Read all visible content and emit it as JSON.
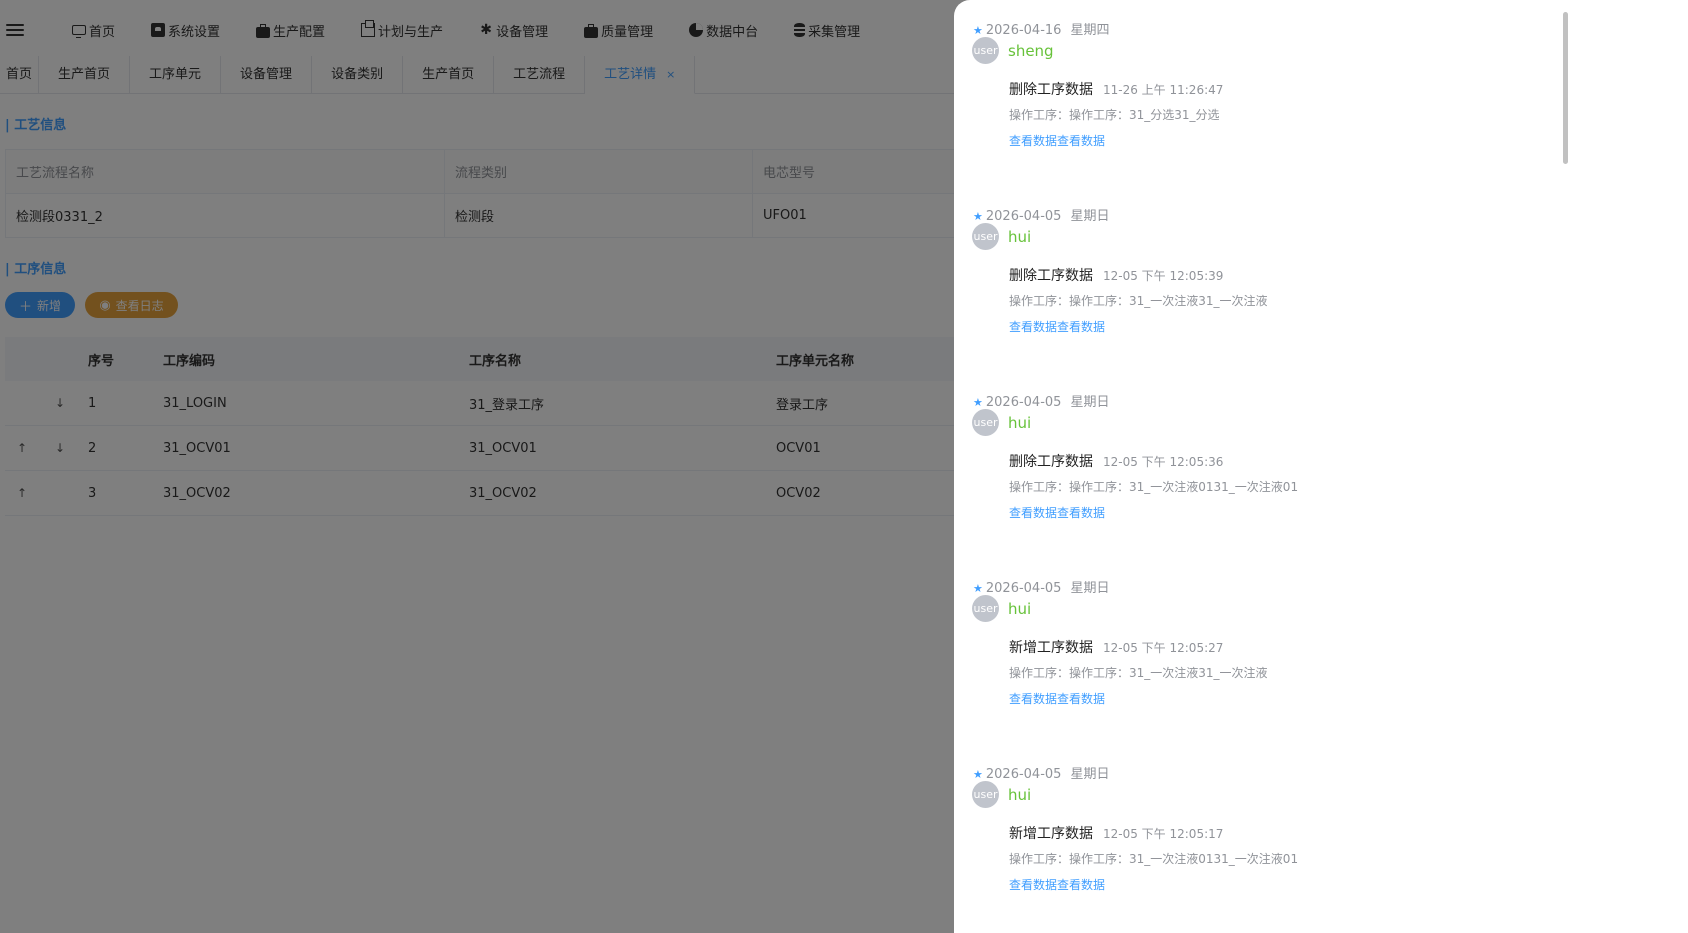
{
  "nav": {
    "items": [
      {
        "label": "首页",
        "icon": "monitor-icon"
      },
      {
        "label": "系统设置",
        "icon": "settings-box-icon"
      },
      {
        "label": "生产配置",
        "icon": "briefcase-icon"
      },
      {
        "label": "计划与生产",
        "icon": "windows-icon"
      },
      {
        "label": "设备管理",
        "icon": "gear-icon"
      },
      {
        "label": "质量管理",
        "icon": "briefcase-icon"
      },
      {
        "label": "数据中台",
        "icon": "pie-chart-icon"
      },
      {
        "label": "采集管理",
        "icon": "database-icon"
      }
    ]
  },
  "tabs": [
    "首页",
    "生产首页",
    "工序单元",
    "设备管理",
    "设备类别",
    "生产首页",
    "工艺流程",
    "工艺详情"
  ],
  "active_tab_close": "×",
  "process_info": {
    "title": "| 工艺信息",
    "headers": [
      "工艺流程名称",
      "流程类别",
      "电芯型号"
    ],
    "values": [
      "检测段0331_2",
      "检测段",
      "UFO01"
    ]
  },
  "step_info": {
    "title": "| 工序信息",
    "add_label": "新增",
    "log_label": "查看日志",
    "columns": [
      "序号",
      "工序编码",
      "工序名称",
      "工序单元名称"
    ],
    "rows": [
      {
        "seq": "1",
        "code": "31_LOGIN",
        "name": "31_登录工序",
        "unit": "登录工序",
        "up": "",
        "down": "↓"
      },
      {
        "seq": "2",
        "code": "31_OCV01",
        "name": "31_OCV01",
        "unit": "OCV01",
        "up": "↑",
        "down": "↓"
      },
      {
        "seq": "3",
        "code": "31_OCV02",
        "name": "31_OCV02",
        "unit": "OCV02",
        "up": "↑",
        "down": ""
      }
    ]
  },
  "log_entries": [
    {
      "date": "2026-04-16",
      "weekday": "星期四",
      "avatar": "user",
      "user": "sheng",
      "action": "删除工序数据",
      "time": "11-26 上午 11:26:47",
      "detail": "操作工序：操作工序：31_分选31_分选",
      "link": "查看数据查看数据"
    },
    {
      "date": "2026-04-05",
      "weekday": "星期日",
      "avatar": "user",
      "user": "hui",
      "action": "删除工序数据",
      "time": "12-05 下午 12:05:39",
      "detail": "操作工序：操作工序：31_一次注液31_一次注液",
      "link": "查看数据查看数据"
    },
    {
      "date": "2026-04-05",
      "weekday": "星期日",
      "avatar": "user",
      "user": "hui",
      "action": "删除工序数据",
      "time": "12-05 下午 12:05:36",
      "detail": "操作工序：操作工序：31_一次注液0131_一次注液01",
      "link": "查看数据查看数据"
    },
    {
      "date": "2026-04-05",
      "weekday": "星期日",
      "avatar": "user",
      "user": "hui",
      "action": "新增工序数据",
      "time": "12-05 下午 12:05:27",
      "detail": "操作工序：操作工序：31_一次注液31_一次注液",
      "link": "查看数据查看数据"
    },
    {
      "date": "2026-04-05",
      "weekday": "星期日",
      "avatar": "user",
      "user": "hui",
      "action": "新增工序数据",
      "time": "12-05 下午 12:05:17",
      "detail": "操作工序：操作工序：31_一次注液0131_一次注液01",
      "link": "查看数据查看数据"
    }
  ]
}
